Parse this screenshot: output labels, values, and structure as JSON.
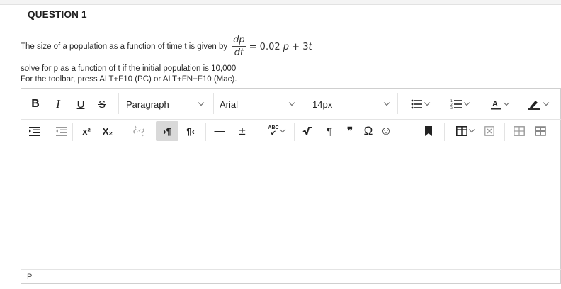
{
  "question": {
    "title": "QUESTION 1",
    "line1_text": "The size of a population as a function of time t is given by",
    "deriv_num": "dp",
    "deriv_den": "dt",
    "rhs_prefix": "= 0.02",
    "rhs_p": "p",
    "rhs_mid": " + 3",
    "rhs_t": "t",
    "line2": "solve for p as a function of t if the initial population is 10,000",
    "line3": "For the toolbar, press ALT+F10 (PC) or ALT+FN+F10 (Mac)."
  },
  "toolbar": {
    "bold": "B",
    "italic": "I",
    "underline": "U",
    "strike": "S",
    "paragraph_format": "Paragraph",
    "font_family": "Arial",
    "font_size": "14px",
    "superscript": "x²",
    "subscript": "X₂",
    "ltr": "›¶",
    "rtl": "¶‹",
    "hr": "—",
    "add": "±",
    "spell": "ABC",
    "para_mark": "¶",
    "quote": "❞",
    "omega": "Ω",
    "emoji": "☺"
  },
  "status": {
    "path": "P"
  },
  "colors": {
    "accent_underline": "#2d2d2d",
    "active_bg": "#d9d9d9"
  }
}
